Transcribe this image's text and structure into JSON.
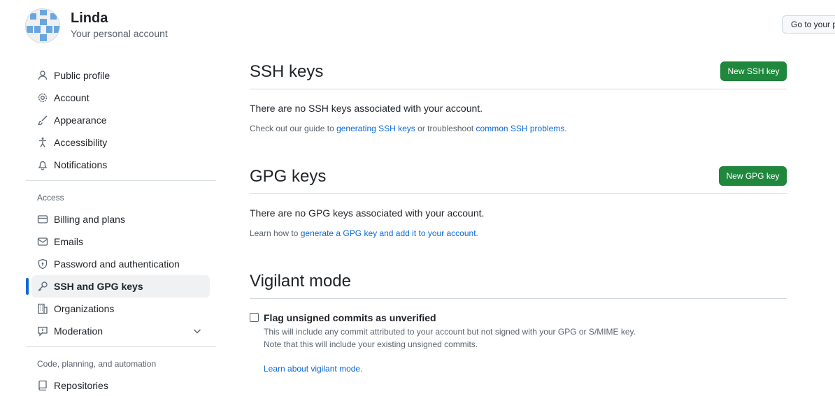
{
  "header": {
    "account_name": "Linda",
    "account_subtitle": "Your personal account",
    "goto_button_label": "Go to your personal profile"
  },
  "sidebar": {
    "items": [
      {
        "label": "Public profile",
        "icon": "person-icon"
      },
      {
        "label": "Account",
        "icon": "gear-icon"
      },
      {
        "label": "Appearance",
        "icon": "paintbrush-icon"
      },
      {
        "label": "Accessibility",
        "icon": "accessibility-icon"
      },
      {
        "label": "Notifications",
        "icon": "bell-icon"
      }
    ],
    "access_label": "Access",
    "access_items": [
      {
        "label": "Billing and plans",
        "icon": "credit-card-icon"
      },
      {
        "label": "Emails",
        "icon": "mail-icon"
      },
      {
        "label": "Password and authentication",
        "icon": "shield-lock-icon"
      },
      {
        "label": "SSH and GPG keys",
        "icon": "key-icon",
        "active": true
      },
      {
        "label": "Organizations",
        "icon": "organization-icon"
      },
      {
        "label": "Moderation",
        "icon": "report-icon"
      }
    ],
    "code_label": "Code, planning, and automation",
    "code_items": [
      {
        "label": "Repositories",
        "icon": "repo-icon"
      }
    ]
  },
  "ssh": {
    "title": "SSH keys",
    "new_button": "New SSH key",
    "empty_text": "There are no SSH keys associated with your account.",
    "help_prefix": "Check out our guide to ",
    "help_link1": "generating SSH keys",
    "help_middle": " or troubleshoot ",
    "help_link2": "common SSH problems",
    "help_suffix": "."
  },
  "gpg": {
    "title": "GPG keys",
    "new_button": "New GPG key",
    "empty_text": "There are no GPG keys associated with your account.",
    "help_prefix": "Learn how to ",
    "help_link": "generate a GPG key and add it to your account",
    "help_suffix": "."
  },
  "vigilant": {
    "title": "Vigilant mode",
    "checkbox_label": "Flag unsigned commits as unverified",
    "checked": false,
    "note1": "This will include any commit attributed to your account but not signed with your GPG or S/MIME key.",
    "note2": "Note that this will include your existing unsigned commits.",
    "learn_link": "Learn about vigilant mode."
  },
  "colors": {
    "primary_button": "#1f883d",
    "link": "#0969da",
    "active_indicator": "#0969da"
  }
}
